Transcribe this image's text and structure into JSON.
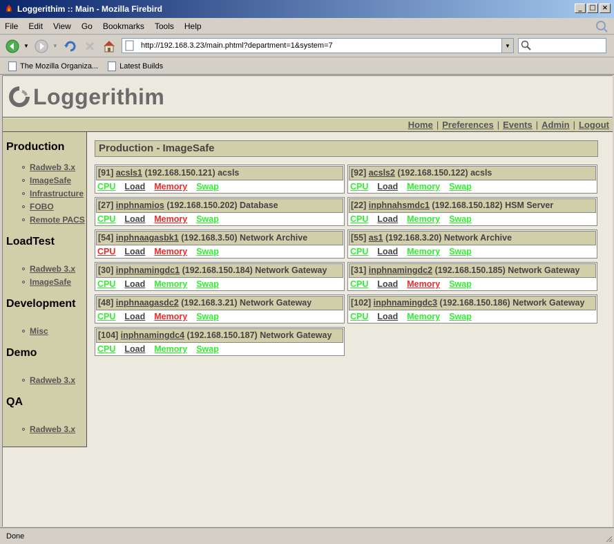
{
  "window": {
    "title": "Loggerithim :: Main - Mozilla Firebird",
    "controls": [
      "_",
      "□",
      "×"
    ]
  },
  "menu": {
    "items": [
      "File",
      "Edit",
      "View",
      "Go",
      "Bookmarks",
      "Tools",
      "Help"
    ]
  },
  "navbar": {
    "url": "http://192.168.3.23/main.phtml?department=1&system=7",
    "search_value": ""
  },
  "bookmarks": {
    "items": [
      "The Mozilla Organiza...",
      "Latest Builds"
    ]
  },
  "page": {
    "logo_text": "Loggerithim",
    "toplinks": [
      "Home",
      "Preferences",
      "Events",
      "Admin",
      "Logout"
    ],
    "sidebar": [
      {
        "title": "Production",
        "items": [
          "Radweb 3.x",
          "ImageSafe",
          "Infrastructure",
          "FOBO",
          "Remote PACS"
        ]
      },
      {
        "title": "LoadTest",
        "items": [
          "Radweb 3.x",
          "ImageSafe"
        ]
      },
      {
        "title": "Development",
        "items": [
          "Misc"
        ]
      },
      {
        "title": "Demo",
        "items": [
          "Radweb 3.x"
        ]
      },
      {
        "title": "QA",
        "items": [
          "Radweb 3.x"
        ]
      }
    ],
    "panel_title": "Production - ImageSafe",
    "metric_labels": [
      "CPU",
      "Load",
      "Memory",
      "Swap"
    ],
    "status_colors": {
      "ok": "#33ee33",
      "alert": "#ee2a2a",
      "neutral": "#444444"
    },
    "hosts": [
      {
        "id": "[91]",
        "name": "acsls1",
        "ip": "(192.168.150.121)",
        "role": "acsls",
        "status": [
          "ok",
          "neutral",
          "alert",
          "ok"
        ]
      },
      {
        "id": "[92]",
        "name": "acsls2",
        "ip": "(192.168.150.122)",
        "role": "acsls",
        "status": [
          "ok",
          "neutral",
          "ok",
          "ok"
        ]
      },
      {
        "id": "[27]",
        "name": "inphnamios",
        "ip": "(192.168.150.202)",
        "role": "Database",
        "status": [
          "ok",
          "neutral",
          "alert",
          "ok"
        ]
      },
      {
        "id": "[22]",
        "name": "inphnahsmdc1",
        "ip": "(192.168.150.182)",
        "role": "HSM Server",
        "status": [
          "ok",
          "neutral",
          "ok",
          "ok"
        ]
      },
      {
        "id": "[54]",
        "name": "inphnaagasbk1",
        "ip": "(192.168.3.50)",
        "role": "Network Archive",
        "status": [
          "alert",
          "neutral",
          "alert",
          "ok"
        ]
      },
      {
        "id": "[55]",
        "name": "as1",
        "ip": "(192.168.3.20)",
        "role": "Network Archive",
        "status": [
          "ok",
          "neutral",
          "ok",
          "ok"
        ]
      },
      {
        "id": "[30]",
        "name": "inphnamingdc1",
        "ip": "(192.168.150.184)",
        "role": "Network Gateway",
        "status": [
          "ok",
          "neutral",
          "ok",
          "ok"
        ]
      },
      {
        "id": "[31]",
        "name": "inphnamingdc2",
        "ip": "(192.168.150.185)",
        "role": "Network Gateway",
        "status": [
          "ok",
          "neutral",
          "alert",
          "ok"
        ]
      },
      {
        "id": "[48]",
        "name": "inphnaagasdc2",
        "ip": "(192.168.3.21)",
        "role": "Network Gateway",
        "status": [
          "ok",
          "neutral",
          "alert",
          "ok"
        ]
      },
      {
        "id": "[102]",
        "name": "inphnamingdc3",
        "ip": "(192.168.150.186)",
        "role": "Network Gateway",
        "status": [
          "ok",
          "neutral",
          "ok",
          "ok"
        ]
      },
      {
        "id": "[104]",
        "name": "inphnamingdc4",
        "ip": "(192.168.150.187)",
        "role": "Network Gateway",
        "status": [
          "ok",
          "neutral",
          "ok",
          "ok"
        ]
      }
    ]
  },
  "status": {
    "text": "Done"
  }
}
